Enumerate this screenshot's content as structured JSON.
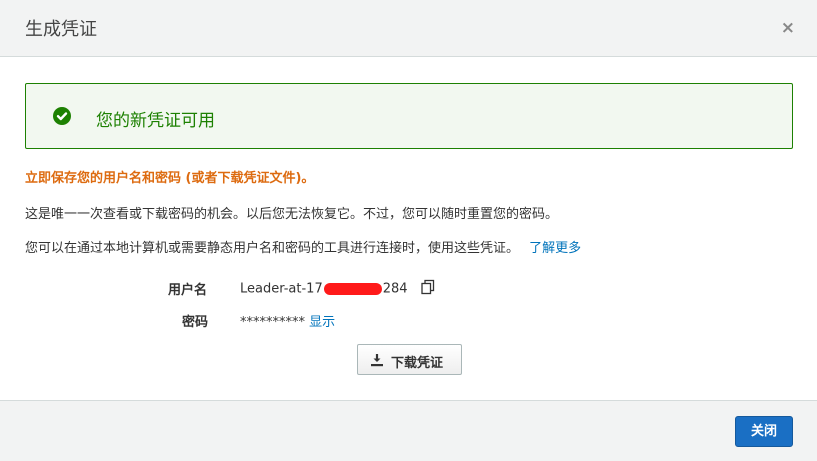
{
  "dialog": {
    "title": "生成凭证",
    "close_glyph": "×"
  },
  "alert": {
    "message": "您的新凭证可用",
    "color": "#1d8102"
  },
  "warning": "立即保存您的用户名和密码 (或者下载凭证文件)。",
  "info1": "这是唯一一次查看或下载密码的机会。以后您无法恢复它。不过，您可以随时重置您的密码。",
  "info2": "您可以在通过本地计算机或需要静态用户名和密码的工具进行连接时，使用这些凭证。",
  "learn_more": "了解更多",
  "credentials": {
    "username_label": "用户名",
    "username_prefix": "Leader-at-17",
    "username_suffix": "284",
    "password_label": "密码",
    "password_mask": "**********",
    "show_link": "显示"
  },
  "download_button": "下载凭证",
  "close_button": "关闭",
  "colors": {
    "warning": "#dd6b10",
    "link": "#0073bb",
    "primary_button": "#1a6fc4"
  }
}
